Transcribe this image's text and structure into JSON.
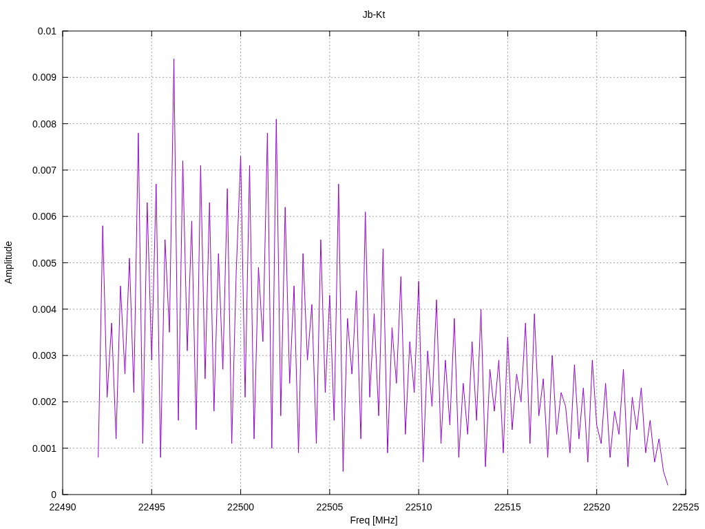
{
  "plot": {
    "chart_data": {
      "type": "line",
      "title": "Jb-Kt",
      "xlabel": "Freq [MHz]",
      "ylabel": "Amplitude",
      "grid": true,
      "xlim": [
        22490,
        22525
      ],
      "ylim": [
        0,
        0.01
      ],
      "xticks": [
        22490,
        22495,
        22500,
        22505,
        22510,
        22515,
        22520,
        22525
      ],
      "yticks": [
        0.01,
        0.009,
        0.008,
        0.007,
        0.006,
        0.005,
        0.004,
        0.003,
        0.002,
        0.001,
        0
      ],
      "x": [
        22492,
        22492.25,
        22492.5,
        22492.75,
        22493,
        22493.25,
        22493.5,
        22493.75,
        22494,
        22494.25,
        22494.5,
        22494.75,
        22495,
        22495.25,
        22495.5,
        22495.75,
        22496,
        22496.25,
        22496.5,
        22496.75,
        22497,
        22497.25,
        22497.5,
        22497.75,
        22498,
        22498.25,
        22498.5,
        22498.75,
        22499,
        22499.25,
        22499.5,
        22499.75,
        22500,
        22500.25,
        22500.5,
        22500.75,
        22501,
        22501.25,
        22501.5,
        22501.75,
        22502,
        22502.25,
        22502.5,
        22502.75,
        22503,
        22503.25,
        22503.5,
        22503.75,
        22504,
        22504.25,
        22504.5,
        22504.75,
        22505,
        22505.25,
        22505.5,
        22505.75,
        22506,
        22506.25,
        22506.5,
        22506.75,
        22507,
        22507.25,
        22507.5,
        22507.75,
        22508,
        22508.25,
        22508.5,
        22508.75,
        22509,
        22509.25,
        22509.5,
        22509.75,
        22510,
        22510.25,
        22510.5,
        22510.75,
        22511,
        22511.25,
        22511.5,
        22511.75,
        22512,
        22512.25,
        22512.5,
        22512.75,
        22513,
        22513.25,
        22513.5,
        22513.75,
        22514,
        22514.25,
        22514.5,
        22514.75,
        22515,
        22515.25,
        22515.5,
        22515.75,
        22516,
        22516.25,
        22516.5,
        22516.75,
        22517,
        22517.25,
        22517.5,
        22517.75,
        22518,
        22518.25,
        22518.5,
        22518.75,
        22519,
        22519.25,
        22519.5,
        22519.75,
        22520,
        22520.25,
        22520.5,
        22520.75,
        22521,
        22521.25,
        22521.5,
        22521.75,
        22522,
        22522.25,
        22522.5,
        22522.75,
        22523,
        22523.25,
        22523.5,
        22523.75,
        22524
      ],
      "series": [
        {
          "color": "#9400d3",
          "values": [
            0.0008,
            0.0058,
            0.0021,
            0.0037,
            0.0012,
            0.0045,
            0.0026,
            0.0051,
            0.0022,
            0.0078,
            0.0011,
            0.0063,
            0.0029,
            0.0067,
            0.0008,
            0.0055,
            0.0035,
            0.0094,
            0.0016,
            0.0072,
            0.0031,
            0.0059,
            0.0014,
            0.0071,
            0.0025,
            0.0063,
            0.0018,
            0.0052,
            0.0027,
            0.0066,
            0.0011,
            0.0048,
            0.0073,
            0.0021,
            0.0071,
            0.0012,
            0.0049,
            0.0033,
            0.0078,
            0.001,
            0.0081,
            0.0017,
            0.0062,
            0.0024,
            0.0045,
            0.0009,
            0.0052,
            0.0029,
            0.0041,
            0.0011,
            0.0055,
            0.0022,
            0.0043,
            0.0016,
            0.0067,
            0.0005,
            0.0038,
            0.0026,
            0.0044,
            0.0012,
            0.0061,
            0.0021,
            0.0039,
            0.0017,
            0.0053,
            0.0009,
            0.0036,
            0.0024,
            0.0047,
            0.0013,
            0.0033,
            0.0022,
            0.0046,
            0.0007,
            0.0031,
            0.0019,
            0.0042,
            0.0011,
            0.0029,
            0.0015,
            0.0038,
            0.0008,
            0.0024,
            0.0013,
            0.0033,
            0.0016,
            0.004,
            0.0006,
            0.0027,
            0.0018,
            0.0029,
            0.0009,
            0.0034,
            0.0014,
            0.0026,
            0.002,
            0.0037,
            0.0011,
            0.0039,
            0.0017,
            0.0025,
            0.0008,
            0.003,
            0.0013,
            0.0022,
            0.0019,
            0.0009,
            0.0028,
            0.0012,
            0.0023,
            0.0007,
            0.0029,
            0.0015,
            0.0011,
            0.0024,
            0.0008,
            0.0018,
            0.0013,
            0.0027,
            0.0006,
            0.0021,
            0.0014,
            0.0023,
            0.0009,
            0.0016,
            0.0007,
            0.0012,
            0.0005,
            0.0002
          ]
        }
      ]
    }
  }
}
